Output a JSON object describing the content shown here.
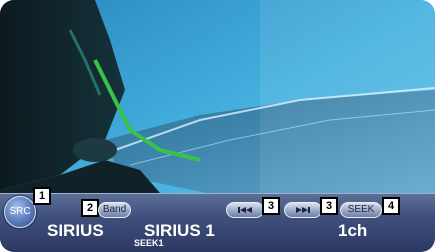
{
  "buttons": {
    "src": "SRC",
    "band": "Band",
    "prev_icon": "skip-previous-icon",
    "next_icon": "skip-next-icon",
    "seek": "SEEK"
  },
  "callouts": {
    "src": "1",
    "band": "2",
    "prev": "3",
    "next": "3",
    "seek": "4"
  },
  "status": {
    "source": "SIRIUS",
    "channel_name": "SIRIUS 1",
    "seek_mode": "SEEK1",
    "channel_number": "1ch"
  },
  "colors": {
    "bar_top": "#5b6f97",
    "bar_bottom": "#2c3862",
    "sky": "#3aa6d8",
    "accent_green": "#38c24a"
  }
}
